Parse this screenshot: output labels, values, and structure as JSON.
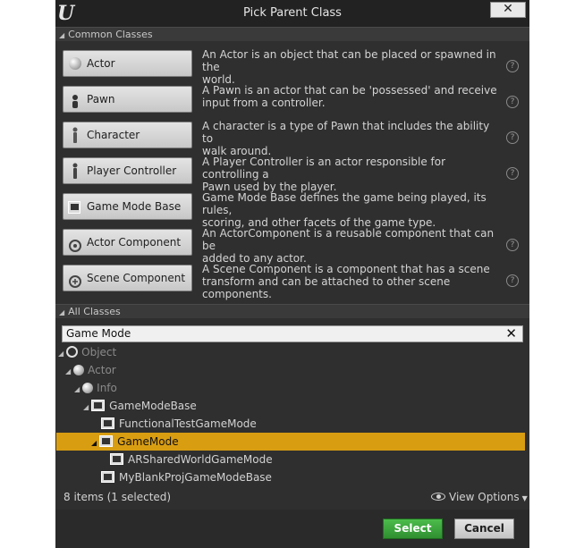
{
  "window": {
    "title": "Pick Parent Class",
    "close_label": "✕"
  },
  "common": {
    "header": "Common Classes",
    "classes": [
      {
        "label": "Actor",
        "description_line1": "An Actor is an object that can be placed or spawned in the",
        "description_line2": "world.",
        "icon": "actor-sphere-icon",
        "help": true
      },
      {
        "label": "Pawn",
        "description_line1": "A Pawn is an actor that can be 'possessed' and receive",
        "description_line2": "input from a controller.",
        "icon": "pawn-icon",
        "help": true
      },
      {
        "label": "Character",
        "description_line1": "A character is a type of Pawn that includes the ability to",
        "description_line2": "walk around.",
        "icon": "character-icon",
        "help": true
      },
      {
        "label": "Player Controller",
        "description_line1": "A Player Controller is an actor responsible for controlling a",
        "description_line2": "Pawn used by the player.",
        "icon": "player-controller-icon",
        "help": true
      },
      {
        "label": "Game Mode Base",
        "description_line1": "Game Mode Base defines the game being played, its rules,",
        "description_line2": "scoring, and other facets of the game type.",
        "icon": "game-mode-icon",
        "help": false
      },
      {
        "label": "Actor Component",
        "description_line1": "An ActorComponent is a reusable component that can be",
        "description_line2": "added to any actor.",
        "icon": "actor-component-icon",
        "help": true
      },
      {
        "label": "Scene Component",
        "description_line1": "A Scene Component is a component that has a scene",
        "description_line2": "transform and can be attached to other scene components.",
        "icon": "scene-component-icon",
        "help": true
      }
    ]
  },
  "all": {
    "header": "All Classes",
    "search_value": "Game Mode",
    "clear_label": "✕",
    "tree": [
      {
        "label": "Object",
        "depth": 0,
        "icon": "object-ring-icon",
        "dim": true,
        "selected": false
      },
      {
        "label": "Actor",
        "depth": 1,
        "icon": "actor-sphere-icon",
        "dim": true,
        "selected": false
      },
      {
        "label": "Info",
        "depth": 2,
        "icon": "info-sphere-icon",
        "dim": true,
        "selected": false
      },
      {
        "label": "GameModeBase",
        "depth": 3,
        "icon": "game-mode-icon",
        "dim": false,
        "selected": false
      },
      {
        "label": "FunctionalTestGameMode",
        "depth": 4,
        "icon": "game-mode-icon",
        "dim": false,
        "selected": false
      },
      {
        "label": "GameMode",
        "depth": 4,
        "icon": "game-mode-icon",
        "dim": false,
        "selected": true
      },
      {
        "label": "ARSharedWorldGameMode",
        "depth": 5,
        "icon": "game-mode-icon",
        "dim": false,
        "selected": false
      },
      {
        "label": "MyBlankProjGameModeBase",
        "depth": 4,
        "icon": "game-mode-icon",
        "dim": false,
        "selected": false
      }
    ],
    "item_count": "8 items (1 selected)",
    "view_options": "View Options"
  },
  "actions": {
    "select_label": "Select",
    "cancel_label": "Cancel"
  }
}
